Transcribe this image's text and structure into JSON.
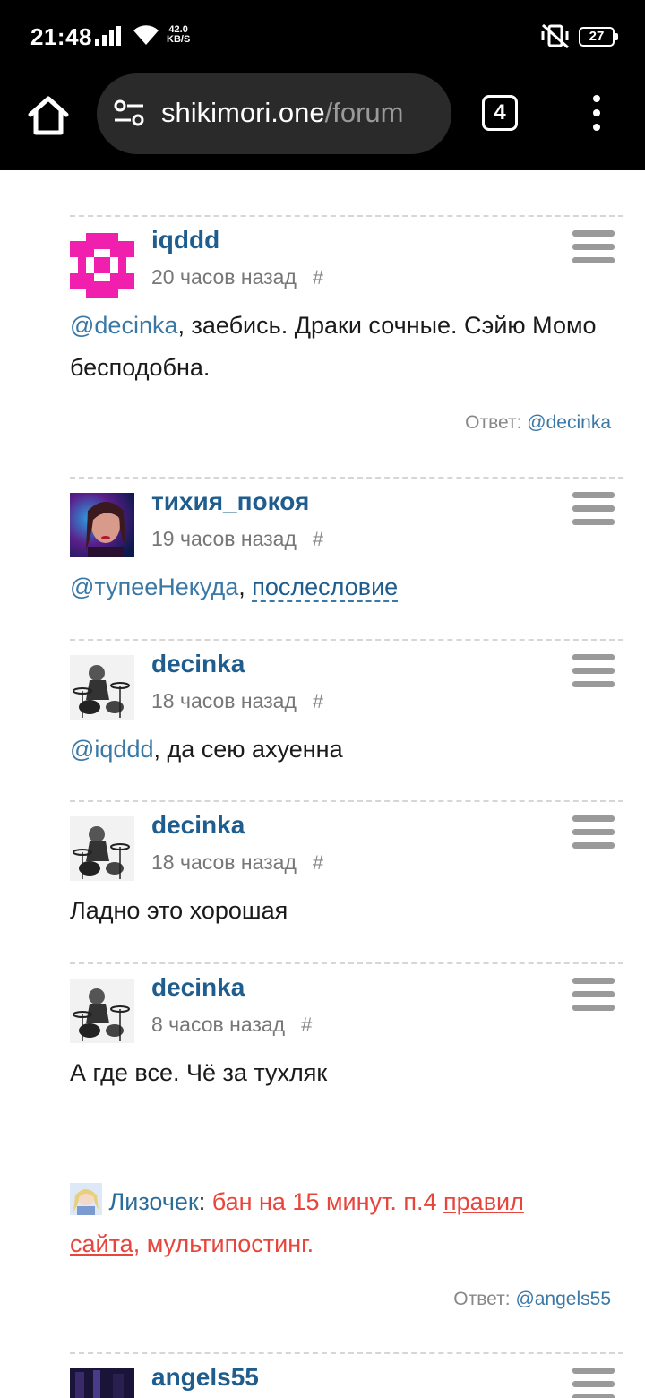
{
  "status_bar": {
    "time": "21:48",
    "net_speed_value": "42.0",
    "net_speed_unit": "KB/S",
    "battery": "27",
    "signal_icon": "signal-icon",
    "wifi_icon": "wifi-icon",
    "mute_icon": "vibrate-mute-icon"
  },
  "browser": {
    "url_domain": "shikimori.one",
    "url_path": "/forum",
    "tabs_count": "4"
  },
  "comments": [
    {
      "username": "iqddd",
      "time": "20 часов назад",
      "hash": "#",
      "mention": "@decinka",
      "text": ", заебись. Драки сочные. Сэйю Момо бесподобна.",
      "reply_label": "Ответ:",
      "reply_to": "@decinka"
    },
    {
      "username": "тихия_покоя",
      "time": "19 часов назад",
      "hash": "#",
      "mention": "@тупееНекуда",
      "sep": ", ",
      "link": "послесловие"
    },
    {
      "username": "decinka",
      "time": "18 часов назад",
      "hash": "#",
      "mention": "@iqddd",
      "text": ", да сею ахуенна"
    },
    {
      "username": "decinka",
      "time": "18 часов назад",
      "hash": "#",
      "text": "Ладно это хорошая"
    },
    {
      "username": "decinka",
      "time": "8 часов назад",
      "hash": "#",
      "text": "А где все. Чё за тухляк",
      "mod_name": "Лизочек",
      "mod_colon": ": ",
      "ban_text": "бан на 15 минут. п.4 ",
      "ban_link": "правил сайта",
      "ban_tail": ", мультипостинг.",
      "reply_label": "Ответ:",
      "reply_to": "@angels55"
    },
    {
      "username": "angels55"
    }
  ],
  "colors": {
    "username": "#1e5d8e",
    "mention": "#3a78a6",
    "ban": "#e8453c"
  }
}
